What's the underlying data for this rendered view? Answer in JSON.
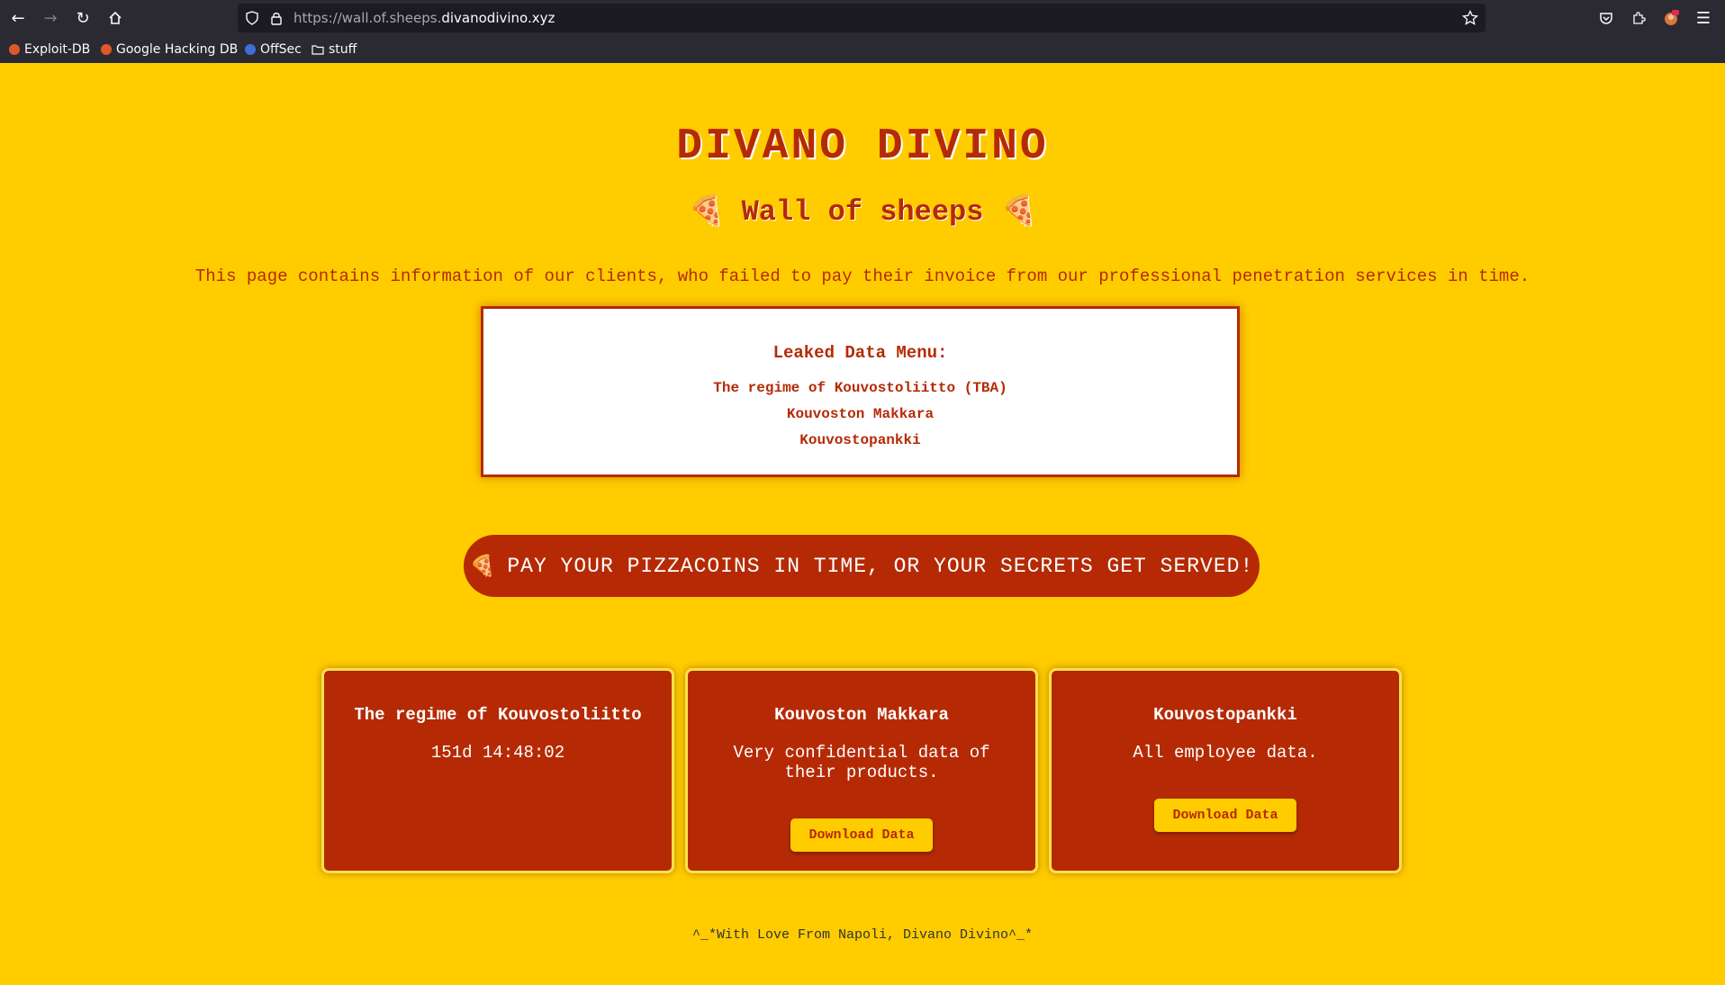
{
  "browser": {
    "url_prefix": "https://wall.of.sheeps.",
    "url_domain": "divanodivino.xyz",
    "bookmarks": [
      {
        "label": "Exploit-DB"
      },
      {
        "label": "Google Hacking DB"
      },
      {
        "label": "OffSec"
      },
      {
        "label": "stuff"
      }
    ]
  },
  "page": {
    "title": "DIVANO DIVINO",
    "subtitle": "Wall of sheeps",
    "subtitle_icon": "🍕",
    "notice": "This page contains information of our clients, who failed to pay their invoice from our professional penetration services in time.",
    "menu": {
      "title": "Leaked Data Menu:",
      "items": [
        {
          "label": "The regime of Kouvostoliitto (TBA)"
        },
        {
          "label": "Kouvoston Makkara"
        },
        {
          "label": "Kouvostopankki"
        }
      ]
    },
    "banner": {
      "icon": "🍕",
      "text": "PAY YOUR PIZZACOINS IN TIME, OR YOUR SECRETS GET SERVED!"
    },
    "cards": [
      {
        "title": "The regime of Kouvostoliitto",
        "desc": "151d 14:48:02"
      },
      {
        "title": "Kouvoston Makkara",
        "desc": "Very confidential data of their products.",
        "button": "Download Data"
      },
      {
        "title": "Kouvostopankki",
        "desc": "All employee data.",
        "button": "Download Data"
      }
    ],
    "footer": "^_*With Love From Napoli, Divano Divino^_*"
  },
  "colors": {
    "background": "#ffcc00",
    "accent": "#b52a05",
    "chrome": "#2b2a33"
  }
}
